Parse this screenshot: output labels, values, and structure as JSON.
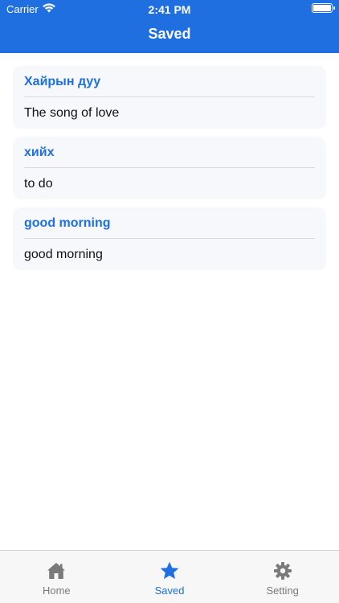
{
  "status_bar": {
    "carrier": "Carrier",
    "time": "2:41 PM"
  },
  "nav": {
    "title": "Saved"
  },
  "saved_items": [
    {
      "word": "Хайрын дуу",
      "meaning": "The song of love"
    },
    {
      "word": "хийх",
      "meaning": "to do"
    },
    {
      "word": "good morning",
      "meaning": "good morning"
    }
  ],
  "tabbar": {
    "items": [
      {
        "label": "Home",
        "icon": "home-icon",
        "active": false
      },
      {
        "label": "Saved",
        "icon": "star-icon",
        "active": true
      },
      {
        "label": "Setting",
        "icon": "gear-icon",
        "active": false
      }
    ]
  },
  "colors": {
    "accent": "#1f6fe0",
    "card_bg": "#f6f8fc",
    "inactive_tab": "#7a7a7a"
  }
}
